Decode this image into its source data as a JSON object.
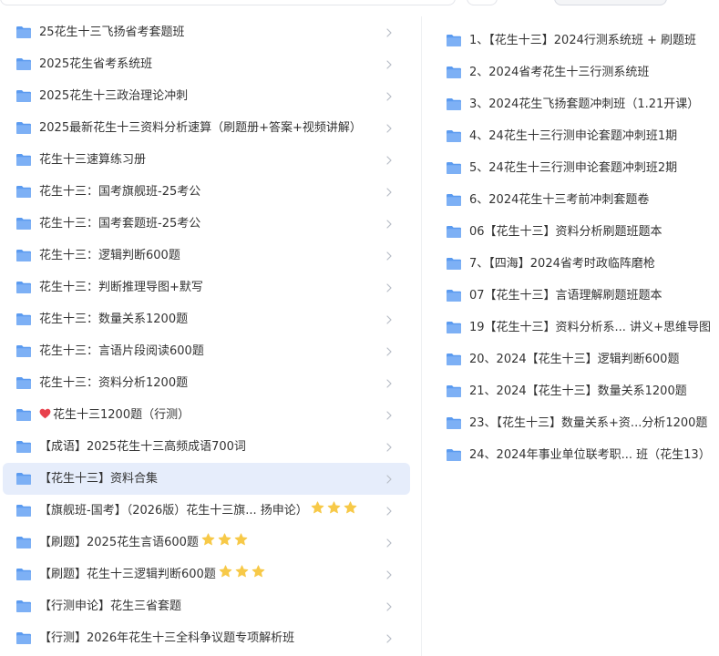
{
  "left_list": {
    "items": [
      {
        "label": "25花生十三飞扬省考套题班"
      },
      {
        "label": "2025花生省考系统班"
      },
      {
        "label": "2025花生十三政治理论冲刺"
      },
      {
        "label": "2025最新花生十三资料分析速算（刷题册+答案+视频讲解）"
      },
      {
        "label": "花生十三速算练习册"
      },
      {
        "label": "花生十三：国考旗舰班-25考公"
      },
      {
        "label": "花生十三：国考套题班-25考公"
      },
      {
        "label": "花生十三：逻辑判断600题"
      },
      {
        "label": "花生十三：判断推理导图+默写"
      },
      {
        "label": "花生十三：数量关系1200题"
      },
      {
        "label": "花生十三：言语片段阅读600题"
      },
      {
        "label": "花生十三：资料分析1200题"
      },
      {
        "label": "花生十三1200题（行测）",
        "prefix_icon": "heart-icon"
      },
      {
        "label": "【成语】2025花生十三高频成语700词"
      },
      {
        "label": "【花生十三】资料合集",
        "selected": true
      },
      {
        "label": "【旗舰班-国考】（2026版）花生十三旗...  扬申论）",
        "suffix_icon": "star-icon",
        "suffix_count": 3
      },
      {
        "label": "【刷题】2025花生言语600题",
        "suffix_icon": "star-icon",
        "suffix_count": 3
      },
      {
        "label": "【刷题】花生十三逻辑判断600题",
        "suffix_icon": "star-icon",
        "suffix_count": 3
      },
      {
        "label": "【行测申论】花生三省套题"
      },
      {
        "label": "【行测】2026年花生十三全科争议题专项解析班"
      }
    ]
  },
  "right_list": {
    "items": [
      {
        "label": "1、【花生十三】2024行测系统班 + 刷题班"
      },
      {
        "label": "2、2024省考花生十三行测系统班"
      },
      {
        "label": "3、2024花生飞扬套题冲刺班（1.21开课）"
      },
      {
        "label": "4、24花生十三行测申论套题冲刺班1期"
      },
      {
        "label": "5、24花生十三行测申论套题冲刺班2期"
      },
      {
        "label": "6、2024花生十三考前冲刺套题卷"
      },
      {
        "label": "06【花生十三】资料分析刷题班题本"
      },
      {
        "label": "7、【四海】2024省考时政临阵磨枪"
      },
      {
        "label": "07【花生十三】言语理解刷题班题本"
      },
      {
        "label": "19【花生十三】资料分析系...  讲义+思维导图"
      },
      {
        "label": "20、2024【花生十三】逻辑判断600题"
      },
      {
        "label": "21、2024【花生十三】数量关系1200题"
      },
      {
        "label": "23、【花生十三】数量关系+资...分析1200题"
      },
      {
        "label": "24、2024年事业单位联考职...  班（花生13）"
      }
    ]
  },
  "colors": {
    "folder": "#7db0f5",
    "folder_tab": "#5b9bf0",
    "selected_bg": "#e6edfb",
    "chevron": "#b9bec7",
    "star": "#f7c948",
    "heart": "#e8414c",
    "text": "#333333"
  },
  "icons": {
    "folder": "folder-icon",
    "chevron": "chevron-right-icon",
    "heart": "heart-icon",
    "star": "star-icon"
  }
}
